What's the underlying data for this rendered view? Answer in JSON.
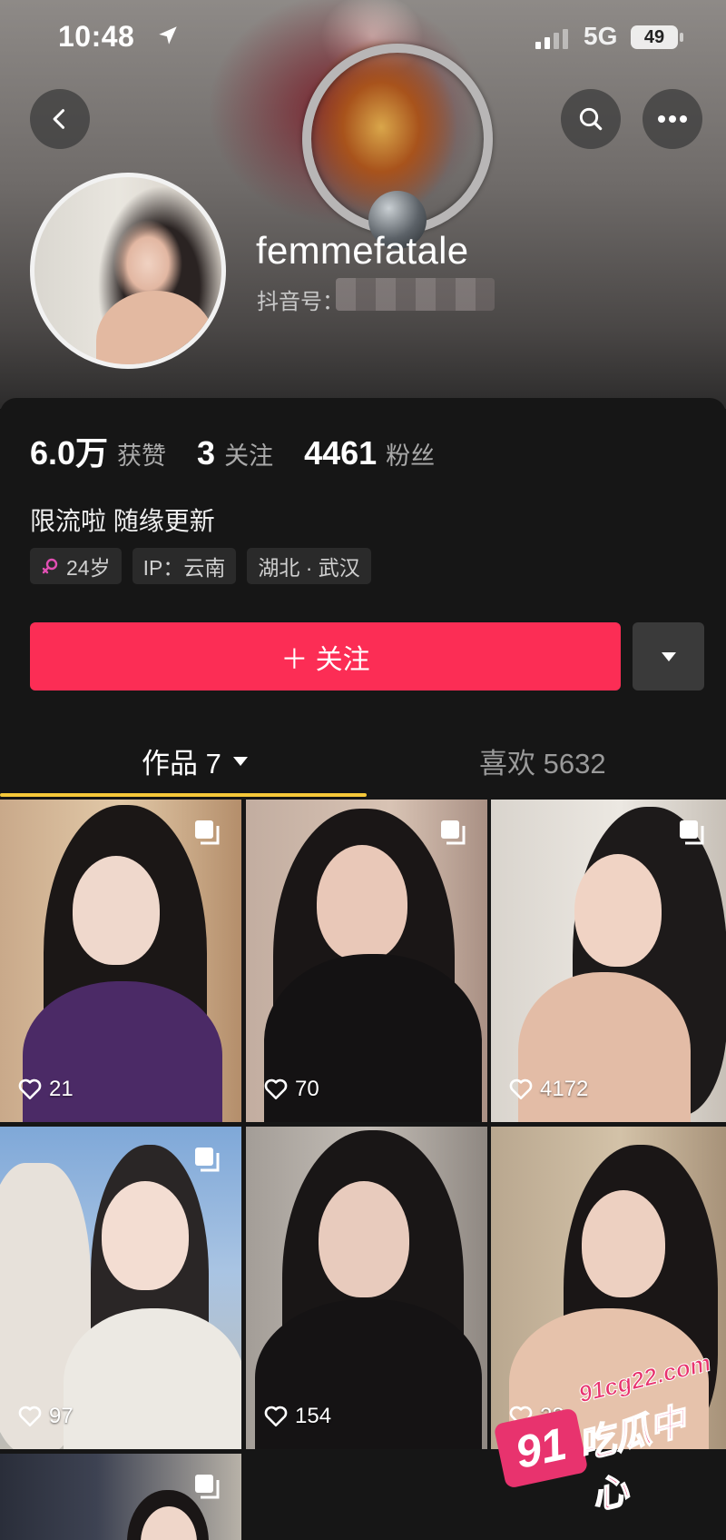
{
  "status_bar": {
    "time": "10:48",
    "network": "5G",
    "battery": "49"
  },
  "profile": {
    "username": "femmefatale",
    "douyin_id_label": "抖音号：",
    "stats": [
      {
        "value": "6.0万",
        "label": "获赞"
      },
      {
        "value": "3",
        "label": "关注"
      },
      {
        "value": "4461",
        "label": "粉丝"
      }
    ],
    "bio": "限流啦 随缘更新",
    "tags": [
      {
        "icon": "female-icon",
        "text": "24岁"
      },
      {
        "icon": "",
        "text": "IP：云南"
      },
      {
        "icon": "",
        "text": "湖北 · 武汉"
      }
    ]
  },
  "actions": {
    "follow_label": "＋ 关注"
  },
  "tabs": [
    {
      "label": "作品 7",
      "active": true
    },
    {
      "label": "喜欢 5632",
      "active": false
    }
  ],
  "posts": [
    {
      "likes": "21",
      "multi": true
    },
    {
      "likes": "70",
      "multi": true
    },
    {
      "likes": "4172",
      "multi": true
    },
    {
      "likes": "97",
      "multi": true
    },
    {
      "likes": "154",
      "multi": false
    },
    {
      "likes": "23",
      "multi": false
    },
    {
      "likes": "",
      "multi": true
    }
  ],
  "watermark": {
    "badge": "91",
    "site": "91cg22.com",
    "name": "吃瓜中心"
  },
  "colors": {
    "accent": "#fc2d55",
    "tab_indicator": "#f5c739",
    "background": "#161616"
  }
}
